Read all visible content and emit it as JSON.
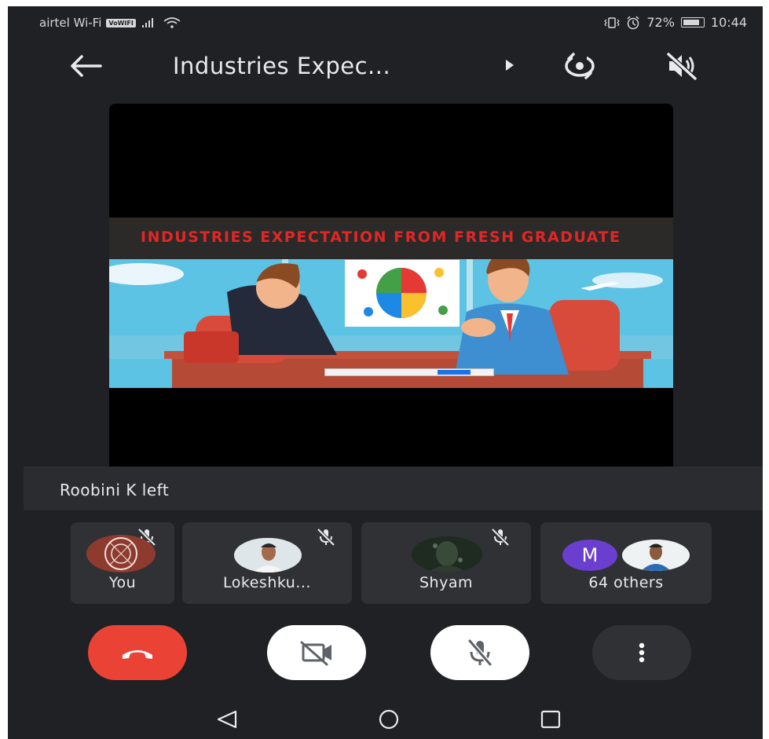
{
  "status_bar": {
    "carrier": "airtel Wi-Fi",
    "volte_badge": "VoWIFI",
    "battery": "72%",
    "battery_level": 0.72,
    "time": "10:44"
  },
  "header": {
    "title": "Industries Expec...",
    "icons": [
      "back-arrow-icon",
      "play-triangle-icon",
      "switch-camera-icon",
      "speaker-off-icon"
    ]
  },
  "presentation": {
    "slide_title": "INDUSTRIES EXPECTATION FROM FRESH GRADUATE"
  },
  "notification": {
    "text": "Roobini K left"
  },
  "participants": [
    {
      "name": "You",
      "muted": true
    },
    {
      "name": "Lokeshku...",
      "muted": true
    },
    {
      "name": "Shyam",
      "muted": true
    },
    {
      "name": "64 others",
      "avatar_letter": "M"
    }
  ],
  "controls": {
    "end_call_color": "#ea4335",
    "icons": [
      "end-call-icon",
      "camera-off-icon",
      "mic-off-icon",
      "more-options-icon"
    ]
  },
  "nav": {
    "icons": [
      "nav-back-icon",
      "nav-home-icon",
      "nav-recents-icon"
    ]
  }
}
